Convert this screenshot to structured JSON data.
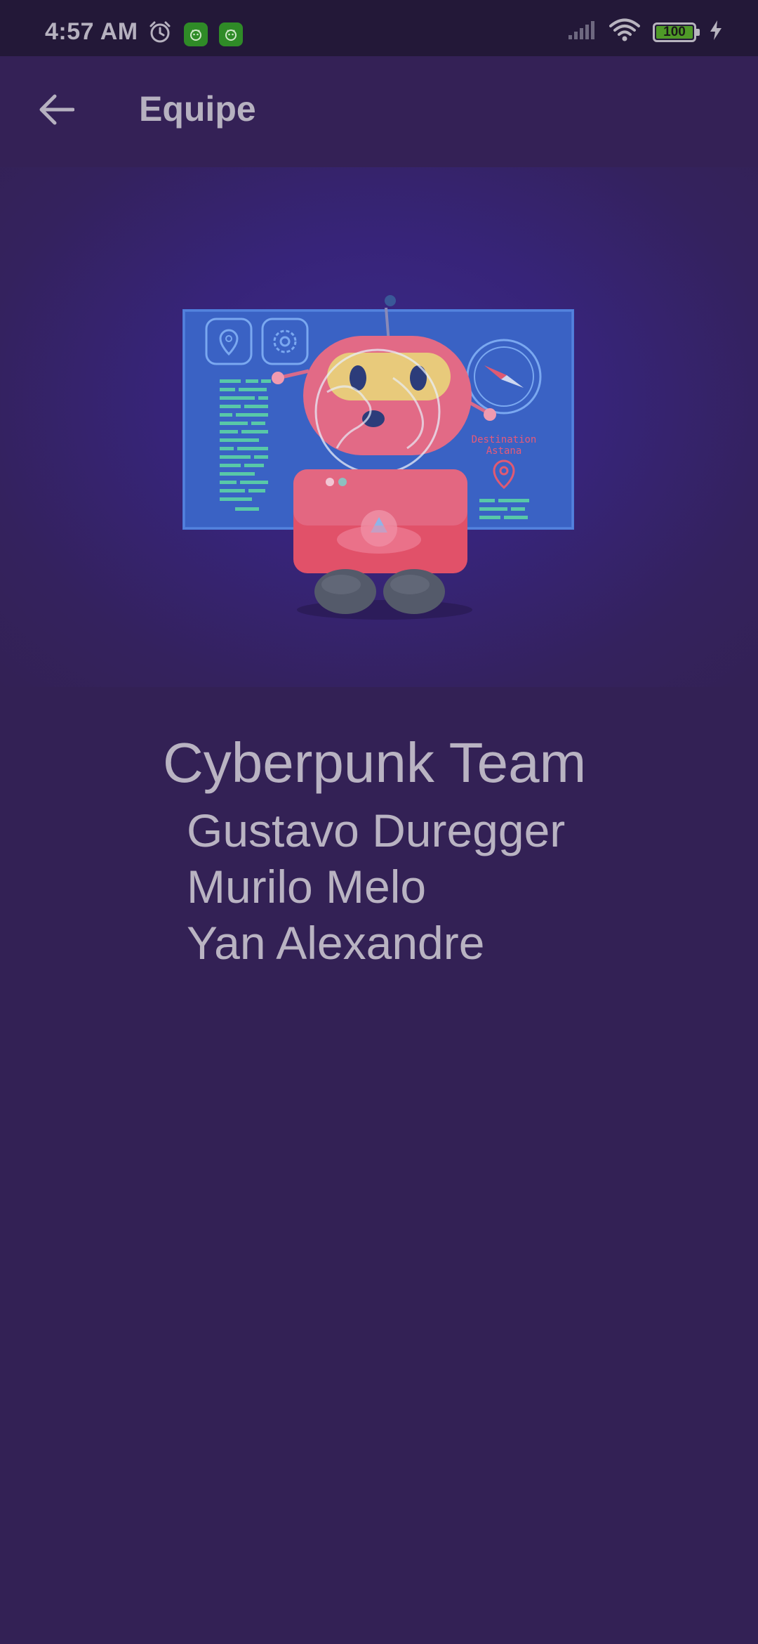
{
  "status_bar": {
    "time": "4:57 AM",
    "battery_level": "100",
    "icons": [
      "alarm-icon",
      "app-notification-icon",
      "app-notification-icon",
      "cellular-signal-icon",
      "wifi-icon",
      "battery-icon",
      "charging-icon"
    ]
  },
  "app_bar": {
    "title": "Equipe",
    "back_icon": "arrow-left-icon"
  },
  "hero": {
    "map_label_line1": "Destination",
    "map_label_line2": "Astana"
  },
  "team": {
    "title": "Cyberpunk Team",
    "members": [
      "Gustavo Duregger",
      "Murilo Melo",
      "Yan Alexandre"
    ]
  },
  "colors": {
    "background": "#332155",
    "status_bar": "#231838",
    "text": "#b9b3c2",
    "screen_blue": "#3a62c4",
    "robot_pink": "#e05574"
  }
}
